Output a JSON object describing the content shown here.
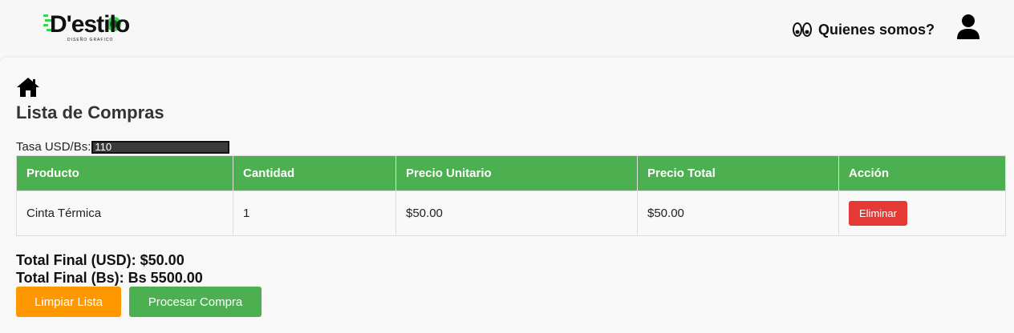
{
  "header": {
    "logo_text": "D'estilo",
    "logo_tagline": "DISEÑO GRAFICO",
    "about_label": "Quienes somos?",
    "about_icon": "eyes-icon",
    "user_icon": "user-icon"
  },
  "page": {
    "home_icon": "home-icon",
    "title": "Lista de Compras",
    "rate_label": "Tasa USD/Bs:",
    "rate_value": "110"
  },
  "table": {
    "headers": [
      "Producto",
      "Cantidad",
      "Precio Unitario",
      "Precio Total",
      "Acción"
    ],
    "rows": [
      {
        "producto": "Cinta Térmica",
        "cantidad": "1",
        "precio_unitario": "$50.00",
        "precio_total": "$50.00",
        "accion": "Eliminar"
      }
    ]
  },
  "totals": {
    "usd": "Total Final (USD): $50.00",
    "bs": "Total Final (Bs): Bs 5500.00"
  },
  "buttons": {
    "clear": "Limpiar Lista",
    "process": "Procesar Compra"
  },
  "colors": {
    "header_green": "#4caf50",
    "delete_red": "#e53935",
    "clear_orange": "#ff9800",
    "process_green": "#4caf50"
  }
}
